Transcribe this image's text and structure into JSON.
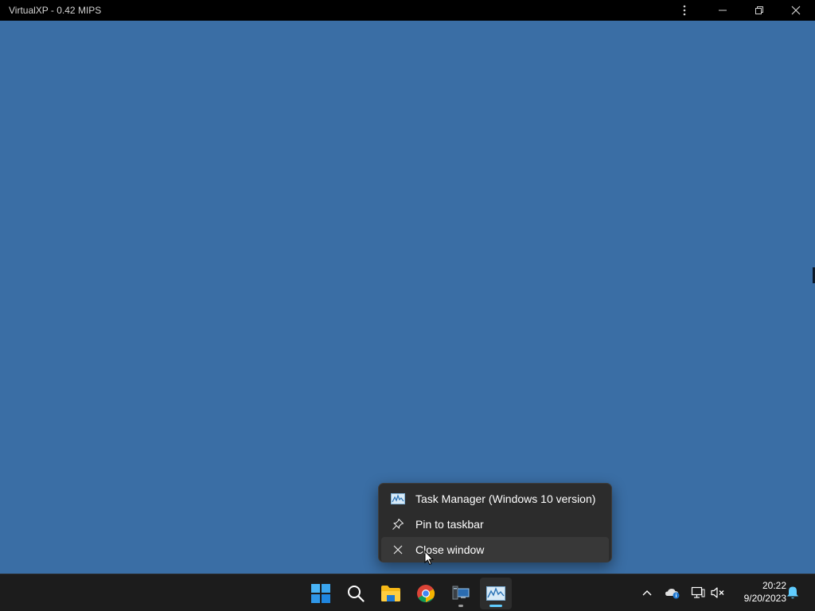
{
  "window": {
    "title": "VirtualXP - 0.42 MIPS",
    "controls": [
      "more",
      "minimize",
      "restore",
      "close"
    ]
  },
  "desktop": {
    "background": "#3a6ea5"
  },
  "context_menu": {
    "items": [
      {
        "label": "Task Manager (Windows 10 version)",
        "icon": "task-manager-icon"
      },
      {
        "label": "Pin to taskbar",
        "icon": "pin-icon"
      },
      {
        "label": "Close window",
        "icon": "close-icon",
        "hovered": true
      }
    ]
  },
  "taskbar": {
    "apps": [
      {
        "name": "start",
        "icon": "windows-logo-icon"
      },
      {
        "name": "search",
        "icon": "search-icon"
      },
      {
        "name": "file-explorer",
        "icon": "folder-icon"
      },
      {
        "name": "chrome",
        "icon": "chrome-icon"
      },
      {
        "name": "virtualxp",
        "icon": "virtualxp-icon",
        "running": true
      },
      {
        "name": "task-manager",
        "icon": "task-manager-icon",
        "active": true
      }
    ],
    "tray": {
      "icons": [
        "chevron-up-icon",
        "onedrive-icon",
        "network-icon",
        "volume-muted-icon"
      ],
      "time": "20:22",
      "date": "9/20/2023",
      "notification_icon": "bell-icon"
    }
  },
  "colors": {
    "accent": "#60cdff",
    "taskbar": "#1c1c1c",
    "menu": "#2c2c2c"
  }
}
